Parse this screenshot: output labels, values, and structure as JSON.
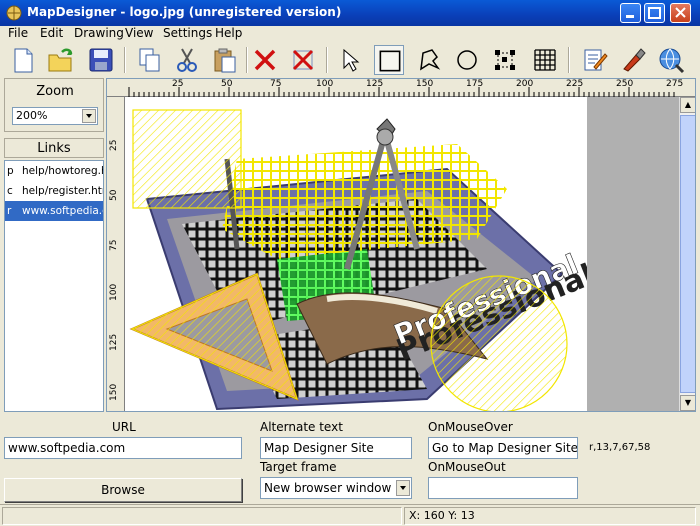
{
  "window": {
    "title": "MapDesigner - logo.jpg (unregistered version)",
    "icon": "app-globe-icon"
  },
  "menu": {
    "items": [
      {
        "label": "File"
      },
      {
        "label": "Edit"
      },
      {
        "label": "Drawing"
      },
      {
        "label": "View"
      },
      {
        "label": "Settings"
      },
      {
        "label": "Help"
      }
    ]
  },
  "toolbar": {
    "buttons": [
      {
        "icon": "new-file-icon"
      },
      {
        "icon": "open-folder-icon"
      },
      {
        "icon": "save-disk-icon"
      },
      {
        "icon": "copy-icon"
      },
      {
        "icon": "cut-scissors-icon"
      },
      {
        "icon": "paste-icon"
      },
      {
        "icon": "delete-x-icon"
      },
      {
        "icon": "delete-all-icon"
      },
      {
        "icon": "pointer-arrow-icon"
      },
      {
        "icon": "rectangle-tool-icon"
      },
      {
        "icon": "polygon-tool-icon"
      },
      {
        "icon": "circle-tool-icon"
      },
      {
        "icon": "node-edit-icon"
      },
      {
        "icon": "grid-icon"
      },
      {
        "icon": "edit-notes-icon"
      },
      {
        "icon": "brush-icon"
      },
      {
        "icon": "preview-browser-icon"
      }
    ]
  },
  "zoom": {
    "label": "Zoom",
    "value": "200%"
  },
  "links": {
    "header": "Links",
    "rows": [
      {
        "type": "p",
        "url": "help/howtoreg.h"
      },
      {
        "type": "c",
        "url": "help/register.htm"
      },
      {
        "type": "r",
        "url": "www.softpedia.co",
        "selected": true
      }
    ]
  },
  "rulers": {
    "horizontal": [
      "25",
      "50",
      "75",
      "100",
      "125",
      "150",
      "175",
      "200",
      "225",
      "250",
      "275"
    ],
    "vertical": [
      "25",
      "50",
      "75",
      "100",
      "125",
      "150"
    ]
  },
  "image": {
    "caption_text": "Professional"
  },
  "properties": {
    "url_label": "URL",
    "url_value": "www.softpedia.com",
    "browse_label": "Browse",
    "alt_label": "Alternate text",
    "alt_value": "Map Designer Site",
    "target_label": "Target frame",
    "target_value": "New browser window",
    "onmouseover_label": "OnMouseOver",
    "onmouseover_value": "Go to Map Designer Site",
    "onmouseout_label": "OnMouseOut",
    "onmouseout_value": "",
    "area_coords": "r,13,7,67,58"
  },
  "status": {
    "coords": "X: 160  Y: 13"
  },
  "colors": {
    "titlebar": "#0a3fb8",
    "selection": "#316ac5",
    "hotspot_yellow": "#f2e600",
    "hotspot_green": "#3cff3c"
  }
}
